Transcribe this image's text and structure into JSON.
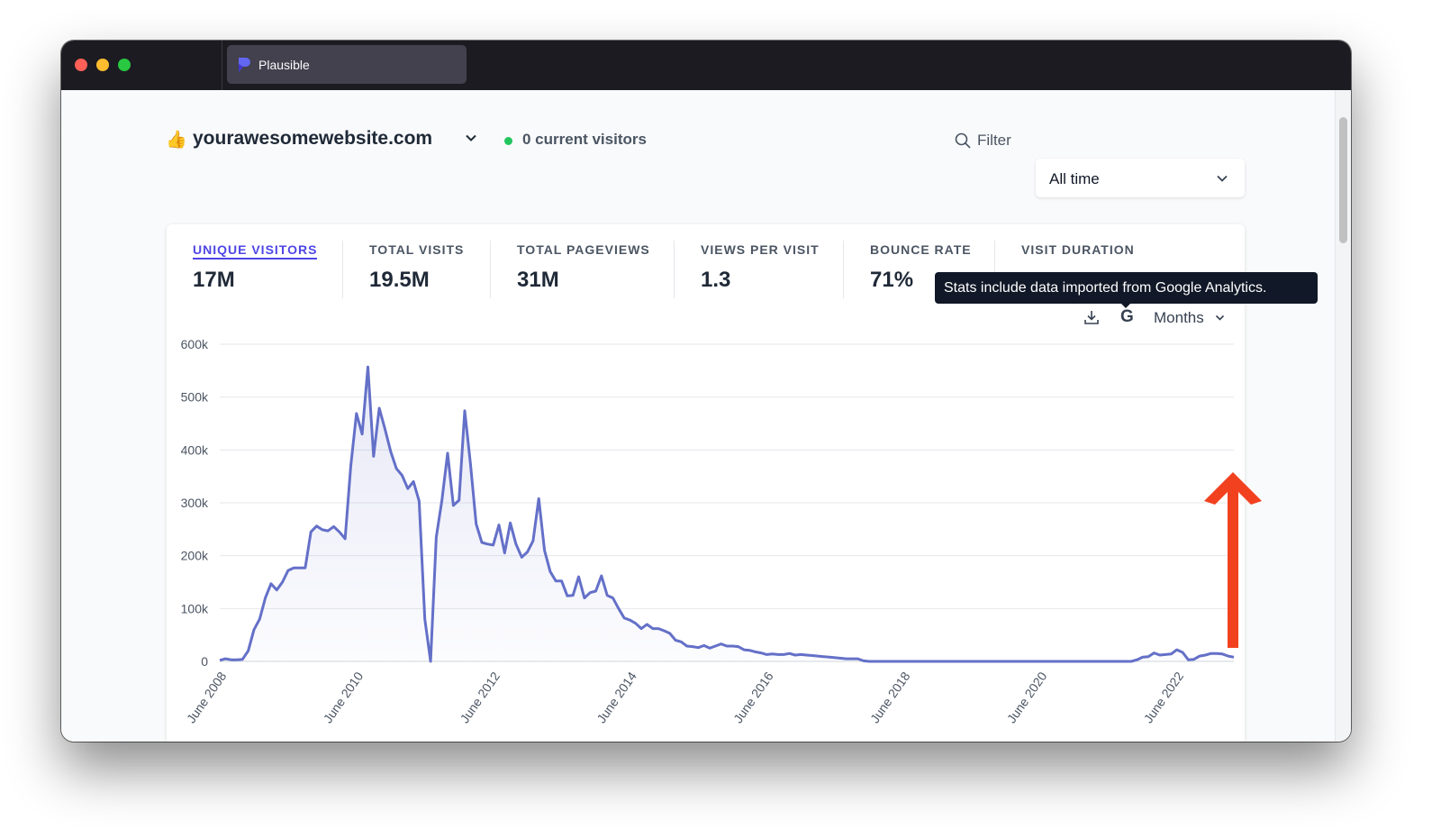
{
  "browser": {
    "tab_title": "Plausible",
    "tab_icon": "plausible-logo-icon"
  },
  "header": {
    "site_emoji": "👍",
    "site_name": "yourawesomewebsite.com",
    "current_visitors": "0 current visitors",
    "filter_label": "Filter",
    "period_label": "All time"
  },
  "metrics": [
    {
      "label": "UNIQUE VISITORS",
      "value": "17M",
      "active": true
    },
    {
      "label": "TOTAL VISITS",
      "value": "19.5M"
    },
    {
      "label": "TOTAL PAGEVIEWS",
      "value": "31M"
    },
    {
      "label": "VIEWS PER VISIT",
      "value": "1.3"
    },
    {
      "label": "BOUNCE RATE",
      "value": "71%"
    },
    {
      "label": "VISIT DURATION",
      "value": ""
    }
  ],
  "chart_controls": {
    "tooltip": "Stats include data imported from Google Analytics.",
    "import_icon_letter": "G",
    "interval_label": "Months"
  },
  "colors": {
    "accent": "#4f46e5",
    "line": "#6470c8",
    "annotation_arrow": "#f2411f"
  },
  "chart_data": {
    "type": "area",
    "title": "",
    "xlabel": "",
    "ylabel": "",
    "ylim": [
      0,
      600000
    ],
    "y_ticks": [
      "0",
      "100k",
      "200k",
      "300k",
      "400k",
      "500k",
      "600k"
    ],
    "x_ticks": [
      "June 2008",
      "June 2010",
      "June 2012",
      "June 2014",
      "June 2016",
      "June 2018",
      "June 2020",
      "June 2022"
    ],
    "grid": true,
    "series": [
      {
        "values": [
          {
            "x": "2008-06",
            "y": 2000
          },
          {
            "x": "2008-07",
            "y": 5000
          },
          {
            "x": "2008-08",
            "y": 3000
          },
          {
            "x": "2008-09",
            "y": 3000
          },
          {
            "x": "2008-10",
            "y": 4000
          },
          {
            "x": "2008-11",
            "y": 20000
          },
          {
            "x": "2008-12",
            "y": 60000
          },
          {
            "x": "2009-01",
            "y": 80000
          },
          {
            "x": "2009-02",
            "y": 120000
          },
          {
            "x": "2009-03",
            "y": 147000
          },
          {
            "x": "2009-04",
            "y": 135000
          },
          {
            "x": "2009-05",
            "y": 150000
          },
          {
            "x": "2009-06",
            "y": 172000
          },
          {
            "x": "2009-07",
            "y": 177000
          },
          {
            "x": "2009-08",
            "y": 177000
          },
          {
            "x": "2009-09",
            "y": 177000
          },
          {
            "x": "2009-10",
            "y": 245000
          },
          {
            "x": "2009-11",
            "y": 256000
          },
          {
            "x": "2009-12",
            "y": 249000
          },
          {
            "x": "2010-01",
            "y": 247000
          },
          {
            "x": "2010-02",
            "y": 255000
          },
          {
            "x": "2010-03",
            "y": 245000
          },
          {
            "x": "2010-04",
            "y": 232000
          },
          {
            "x": "2010-05",
            "y": 370000
          },
          {
            "x": "2010-06",
            "y": 469000
          },
          {
            "x": "2010-07",
            "y": 430000
          },
          {
            "x": "2010-08",
            "y": 557000
          },
          {
            "x": "2010-09",
            "y": 388000
          },
          {
            "x": "2010-10",
            "y": 479000
          },
          {
            "x": "2010-11",
            "y": 440000
          },
          {
            "x": "2010-12",
            "y": 397000
          },
          {
            "x": "2011-01",
            "y": 365000
          },
          {
            "x": "2011-02",
            "y": 352000
          },
          {
            "x": "2011-03",
            "y": 327000
          },
          {
            "x": "2011-04",
            "y": 340000
          },
          {
            "x": "2011-05",
            "y": 303000
          },
          {
            "x": "2011-06",
            "y": 80000
          },
          {
            "x": "2011-07",
            "y": 0
          },
          {
            "x": "2011-08",
            "y": 235000
          },
          {
            "x": "2011-09",
            "y": 305000
          },
          {
            "x": "2011-10",
            "y": 394000
          },
          {
            "x": "2011-11",
            "y": 295000
          },
          {
            "x": "2011-12",
            "y": 305000
          },
          {
            "x": "2012-01",
            "y": 474000
          },
          {
            "x": "2012-02",
            "y": 375000
          },
          {
            "x": "2012-03",
            "y": 260000
          },
          {
            "x": "2012-04",
            "y": 225000
          },
          {
            "x": "2012-05",
            "y": 222000
          },
          {
            "x": "2012-06",
            "y": 220000
          },
          {
            "x": "2012-07",
            "y": 258000
          },
          {
            "x": "2012-08",
            "y": 205000
          },
          {
            "x": "2012-09",
            "y": 262000
          },
          {
            "x": "2012-10",
            "y": 222000
          },
          {
            "x": "2012-11",
            "y": 197000
          },
          {
            "x": "2012-12",
            "y": 207000
          },
          {
            "x": "2013-01",
            "y": 228000
          },
          {
            "x": "2013-02",
            "y": 308000
          },
          {
            "x": "2013-03",
            "y": 210000
          },
          {
            "x": "2013-04",
            "y": 170000
          },
          {
            "x": "2013-05",
            "y": 152000
          },
          {
            "x": "2013-06",
            "y": 152000
          },
          {
            "x": "2013-07",
            "y": 124000
          },
          {
            "x": "2013-08",
            "y": 125000
          },
          {
            "x": "2013-09",
            "y": 160000
          },
          {
            "x": "2013-10",
            "y": 120000
          },
          {
            "x": "2013-11",
            "y": 130000
          },
          {
            "x": "2013-12",
            "y": 133000
          },
          {
            "x": "2014-01",
            "y": 162000
          },
          {
            "x": "2014-02",
            "y": 125000
          },
          {
            "x": "2014-03",
            "y": 120000
          },
          {
            "x": "2014-04",
            "y": 100000
          },
          {
            "x": "2014-05",
            "y": 82000
          },
          {
            "x": "2014-06",
            "y": 78000
          },
          {
            "x": "2014-07",
            "y": 72000
          },
          {
            "x": "2014-08",
            "y": 62000
          },
          {
            "x": "2014-09",
            "y": 70000
          },
          {
            "x": "2014-10",
            "y": 62000
          },
          {
            "x": "2014-11",
            "y": 62000
          },
          {
            "x": "2014-12",
            "y": 58000
          },
          {
            "x": "2015-01",
            "y": 53000
          },
          {
            "x": "2015-02",
            "y": 40000
          },
          {
            "x": "2015-03",
            "y": 37000
          },
          {
            "x": "2015-04",
            "y": 29000
          },
          {
            "x": "2015-05",
            "y": 28000
          },
          {
            "x": "2015-06",
            "y": 26000
          },
          {
            "x": "2015-07",
            "y": 30000
          },
          {
            "x": "2015-08",
            "y": 25000
          },
          {
            "x": "2015-09",
            "y": 29000
          },
          {
            "x": "2015-10",
            "y": 33000
          },
          {
            "x": "2015-11",
            "y": 29000
          },
          {
            "x": "2015-12",
            "y": 29000
          },
          {
            "x": "2016-01",
            "y": 28000
          },
          {
            "x": "2016-02",
            "y": 22000
          },
          {
            "x": "2016-03",
            "y": 21000
          },
          {
            "x": "2016-04",
            "y": 18000
          },
          {
            "x": "2016-05",
            "y": 16000
          },
          {
            "x": "2016-06",
            "y": 13000
          },
          {
            "x": "2016-07",
            "y": 14000
          },
          {
            "x": "2016-08",
            "y": 13000
          },
          {
            "x": "2016-09",
            "y": 13000
          },
          {
            "x": "2016-10",
            "y": 15000
          },
          {
            "x": "2016-11",
            "y": 12000
          },
          {
            "x": "2016-12",
            "y": 13000
          },
          {
            "x": "2017-01",
            "y": 12000
          },
          {
            "x": "2017-02",
            "y": 11000
          },
          {
            "x": "2017-03",
            "y": 10000
          },
          {
            "x": "2017-04",
            "y": 9000
          },
          {
            "x": "2017-05",
            "y": 8000
          },
          {
            "x": "2017-06",
            "y": 7000
          },
          {
            "x": "2017-07",
            "y": 6000
          },
          {
            "x": "2017-08",
            "y": 5000
          },
          {
            "x": "2017-09",
            "y": 5000
          },
          {
            "x": "2017-10",
            "y": 5000
          },
          {
            "x": "2017-11",
            "y": 1000
          },
          {
            "x": "2017-12",
            "y": 0
          },
          {
            "x": "2018-01",
            "y": 0
          },
          {
            "x": "2021-10",
            "y": 0
          },
          {
            "x": "2021-11",
            "y": 3000
          },
          {
            "x": "2021-12",
            "y": 8000
          },
          {
            "x": "2022-01",
            "y": 9000
          },
          {
            "x": "2022-02",
            "y": 16000
          },
          {
            "x": "2022-03",
            "y": 12000
          },
          {
            "x": "2022-04",
            "y": 13000
          },
          {
            "x": "2022-05",
            "y": 14000
          },
          {
            "x": "2022-06",
            "y": 22000
          },
          {
            "x": "2022-07",
            "y": 17000
          },
          {
            "x": "2022-08",
            "y": 3000
          },
          {
            "x": "2022-09",
            "y": 4000
          },
          {
            "x": "2022-10",
            "y": 10000
          },
          {
            "x": "2022-11",
            "y": 12000
          },
          {
            "x": "2022-12",
            "y": 15000
          },
          {
            "x": "2023-01",
            "y": 15000
          },
          {
            "x": "2023-02",
            "y": 14000
          },
          {
            "x": "2023-03",
            "y": 10000
          },
          {
            "x": "2023-04",
            "y": 8000
          }
        ]
      }
    ]
  }
}
